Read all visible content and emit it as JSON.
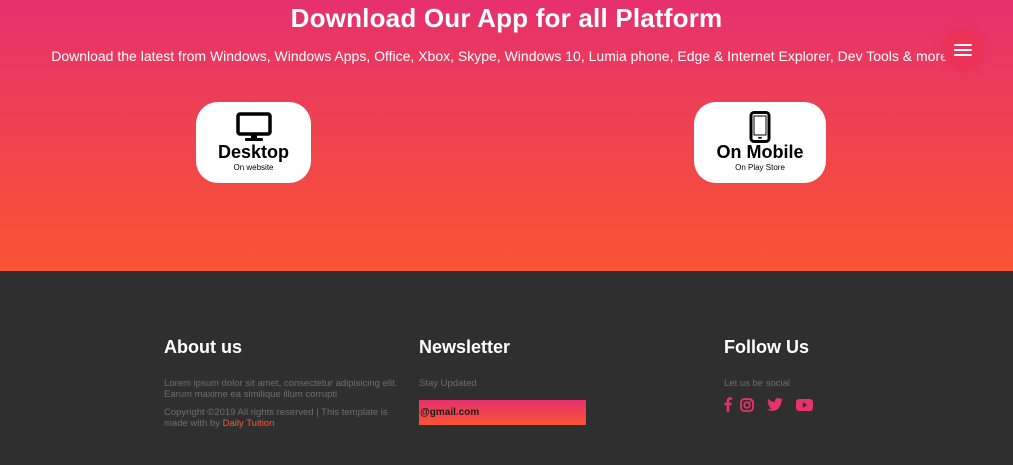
{
  "hero": {
    "title": "Download Our App for all Platform",
    "subtitle": "Download the latest from Windows, Windows Apps, Office, Xbox, Skype, Windows 10, Lumia phone, Edge & Internet Explorer, Dev Tools & more.",
    "cards": [
      {
        "title": "Desktop",
        "subtitle": "On website",
        "icon": "desktop-icon"
      },
      {
        "title": "On Mobile",
        "subtitle": "On Play Store",
        "icon": "mobile-icon"
      }
    ]
  },
  "menu": {
    "icon": "hamburger-menu-icon"
  },
  "footer": {
    "about": {
      "heading": "About us",
      "text": "Lorem ipsum dolor sit amet, consectetur adipisicing elit. Earum maxime ea similique illum corrupti",
      "copyright_prefix": "Copyright ©2019 All rights reserved | This template is made with by ",
      "copyright_link": "Daily Tuition"
    },
    "newsletter": {
      "heading": "Newsletter",
      "label": "Stay Updated",
      "email_value": "@gmail.com"
    },
    "follow": {
      "heading": "Follow Us",
      "label": "Let us be social",
      "icons": [
        "facebook-icon",
        "instagram-icon",
        "twitter-icon",
        "youtube-icon"
      ]
    }
  },
  "colors": {
    "gradient_top": "#e6306e",
    "gradient_bottom": "#fb5432",
    "footer_bg": "#2f2f2f",
    "accent": "#ff5434",
    "social_icon": "#e8336a"
  }
}
